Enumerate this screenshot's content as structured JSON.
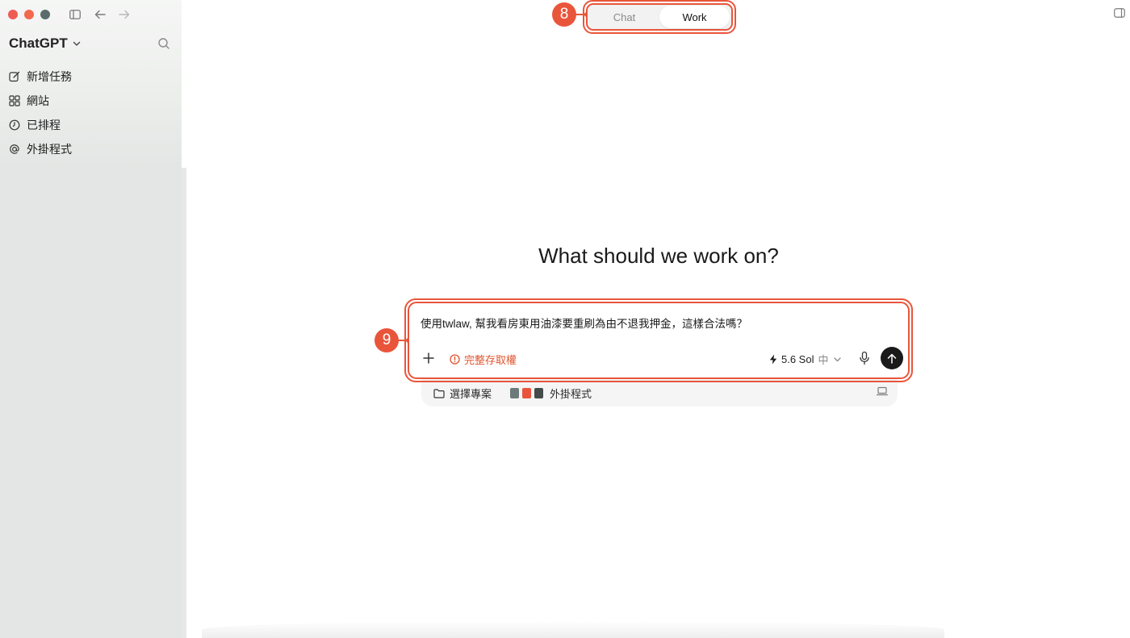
{
  "sidebar": {
    "brand": "ChatGPT",
    "items": [
      {
        "label": "新增任務",
        "icon": "edit-icon"
      },
      {
        "label": "網站",
        "icon": "apps-grid-icon"
      },
      {
        "label": "已排程",
        "icon": "clock-icon"
      },
      {
        "label": "外掛程式",
        "icon": "at-sign-icon"
      }
    ]
  },
  "topbar": {
    "tabs": [
      {
        "label": "Chat",
        "active": false
      },
      {
        "label": "Work",
        "active": true
      }
    ]
  },
  "annotations": {
    "toggle_badge": "8",
    "composer_badge": "9",
    "color": "#e9553b"
  },
  "main": {
    "headline": "What should we work on?",
    "composer": {
      "prompt_value": "使用twlaw, 幫我看房東用油漆要重刷為由不退我押金，這樣合法嗎？",
      "access_label": "完整存取權",
      "model_label": "5.6 Sol",
      "level_label": "中"
    },
    "subbar": {
      "project_label": "選擇專案",
      "plugins_label": "外掛程式"
    }
  }
}
